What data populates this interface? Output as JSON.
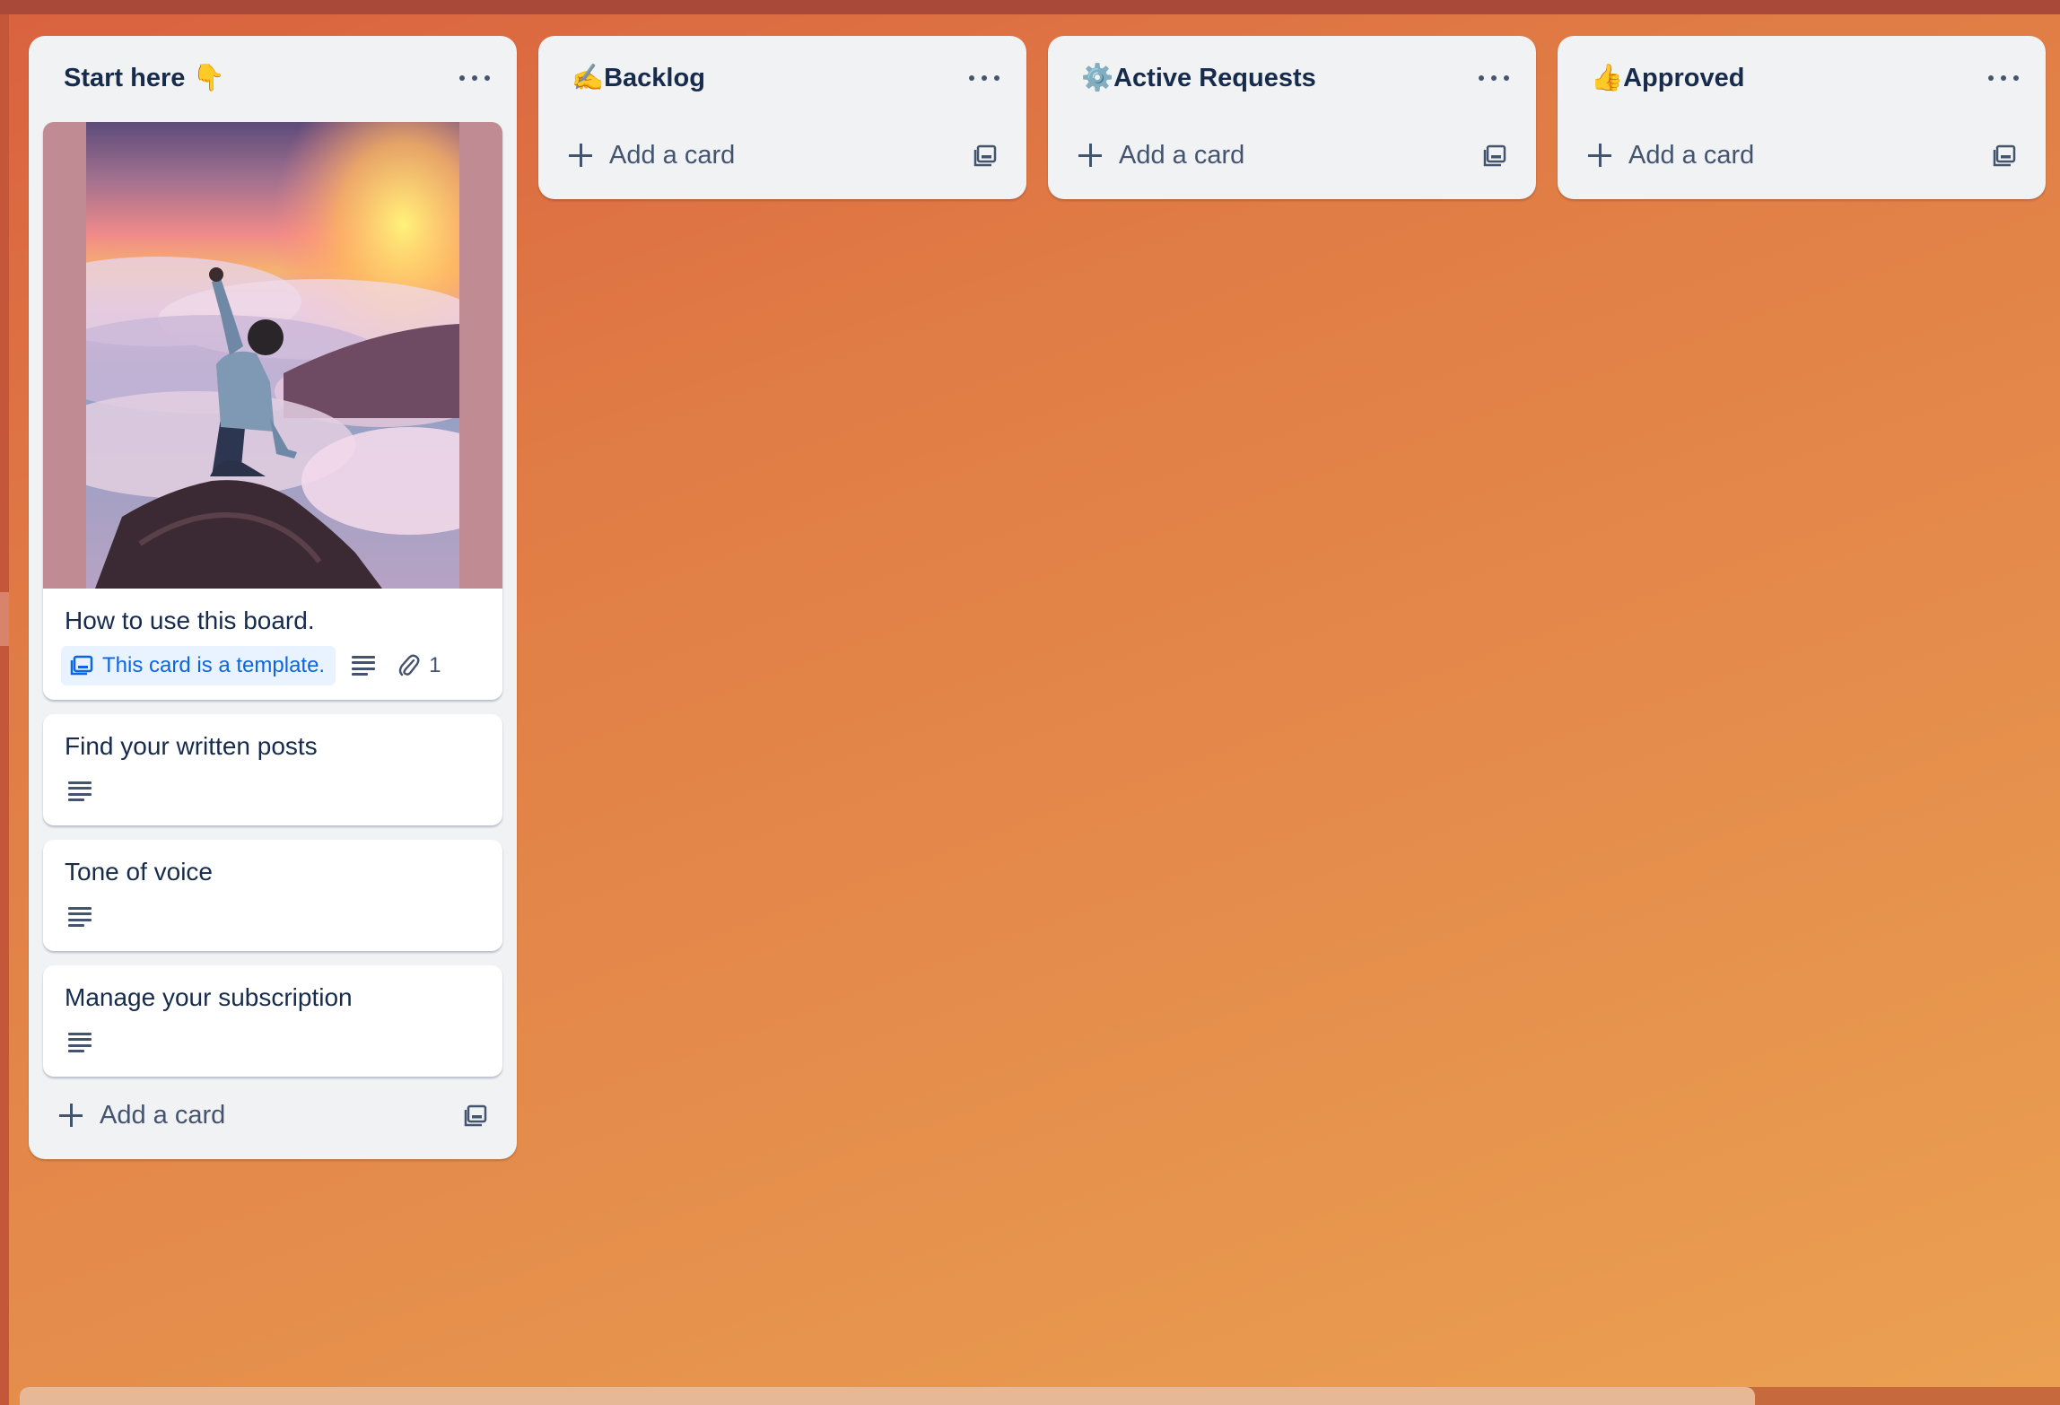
{
  "colors": {
    "list_bg": "#f1f2f4",
    "card_bg": "#ffffff",
    "text_primary": "#172b4d",
    "text_subtle": "#44546f",
    "template_badge_bg": "#e9f2ff",
    "template_badge_text": "#0c66e4",
    "cover_bg": "#c08b93"
  },
  "lists": [
    {
      "title": "Start here 👇",
      "menu_icon": "ellipsis-icon",
      "cards": [
        {
          "title": "How to use this board.",
          "cover": "sunset-mountain-photo",
          "template_badge": "This card is a template.",
          "has_description": true,
          "attachments": "1"
        },
        {
          "title": "Find your written posts",
          "has_description": true
        },
        {
          "title": "Tone of voice",
          "has_description": true
        },
        {
          "title": "Manage your subscription",
          "has_description": true
        }
      ],
      "add_card_label": "Add a card"
    },
    {
      "title": "✍️Backlog",
      "menu_icon": "ellipsis-icon",
      "cards": [],
      "add_card_label": "Add a card"
    },
    {
      "title": "⚙️Active Requests",
      "menu_icon": "ellipsis-icon",
      "cards": [],
      "add_card_label": "Add a card"
    },
    {
      "title": "👍Approved",
      "menu_icon": "ellipsis-icon",
      "cards": [],
      "add_card_label": "Add a card"
    }
  ]
}
